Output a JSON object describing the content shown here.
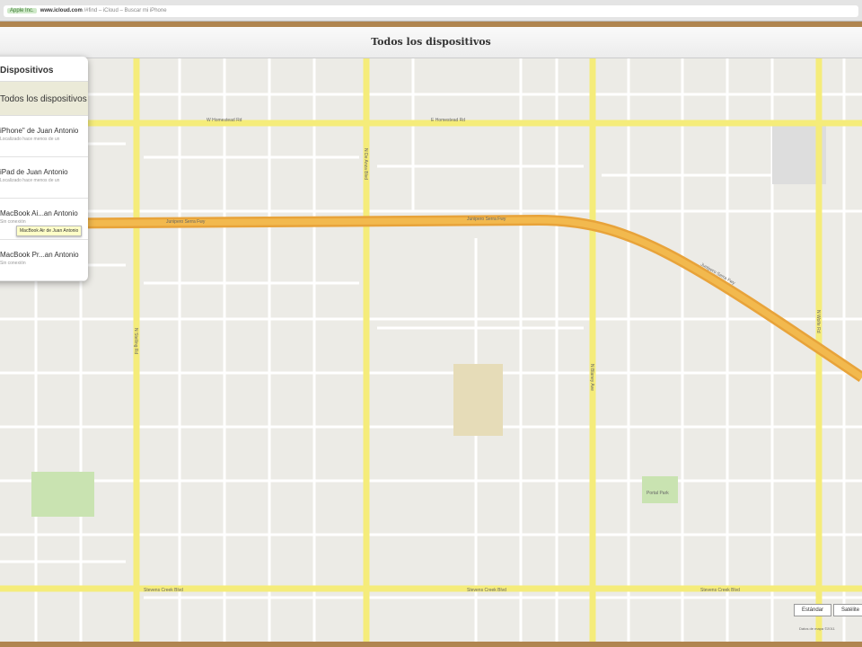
{
  "browser": {
    "cert": "Apple Inc.",
    "domain": "www.icloud.com",
    "path": "/#find – iCloud – Buscar mi iPhone"
  },
  "header": {
    "title": "Todos los dispositivos"
  },
  "panel": {
    "title": "Dispositivos",
    "all": "Todos los dispositivos",
    "devices": [
      {
        "name": "iPhone\" de Juan Antonio",
        "status": "Localizado hace menos de un"
      },
      {
        "name": "iPad de Juan Antonio",
        "status": "Localizado hace menos de un"
      },
      {
        "name": "MacBook Ai...an Antonio",
        "status": "Sin conexión"
      },
      {
        "name": "MacBook Pr...an Antonio",
        "status": "Sin conexión"
      }
    ],
    "tooltip": "MacBook Air de Juan Antonio"
  },
  "map": {
    "streets": {
      "homestead_w": "W Homestead Rd",
      "homestead_e": "E Homestead Rd",
      "fwy1": "Junipero Serra Fwy",
      "fwy2": "Junipero Serra Fwy",
      "fwy3": "Junipero Serra Fwy",
      "stevens1": "Stevens Creek Blvd",
      "stevens2": "Stevens Creek Blvd",
      "stevens3": "Stevens Creek Blvd",
      "stelling": "N Stelling Rd",
      "deanza": "N De Anza Blvd",
      "blaney": "N Blaney Ave",
      "wolfe": "N Wolfe Rd",
      "park": "Portal Park"
    },
    "buttons": {
      "standard": "Estándar",
      "satellite": "Satélite"
    },
    "copyright": "Datos de mapa ©2011"
  }
}
